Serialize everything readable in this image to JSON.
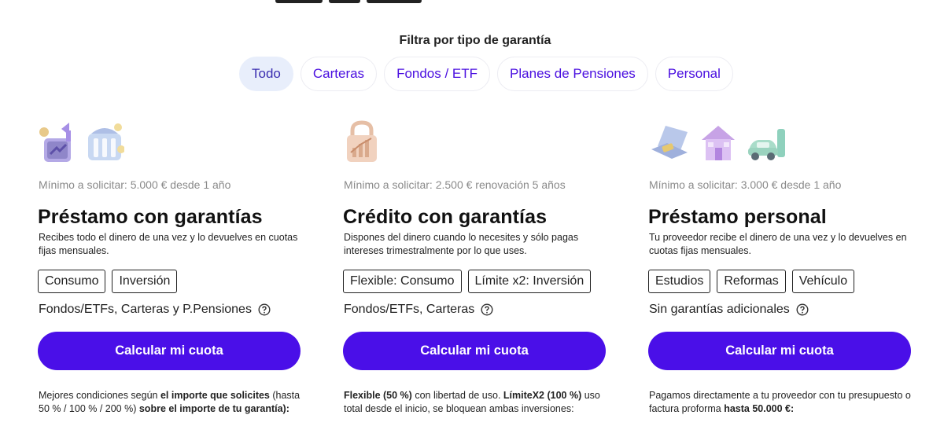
{
  "filter": {
    "title": "Filtra por tipo de garantía",
    "tabs": [
      {
        "label": "Todo",
        "active": true
      },
      {
        "label": "Carteras",
        "active": false
      },
      {
        "label": "Fondos / ETF",
        "active": false
      },
      {
        "label": "Planes de Pensiones",
        "active": false
      },
      {
        "label": "Personal",
        "active": false
      }
    ]
  },
  "colors": {
    "accent": "#4a0fe8",
    "tab_text": "#4b10e0",
    "tab_active_bg": "#e8eefb",
    "muted": "#8a8a8a"
  },
  "cards": [
    {
      "icons": [
        "graph-arrow-icon",
        "bank-building-icon"
      ],
      "minimum": "Mínimo a solicitar: 5.000 € desde 1 año",
      "title": "Préstamo con garantías",
      "description": "Recibes todo el dinero de una vez y lo devuelves en cuotas fijas mensuales.",
      "tags": [
        "Consumo",
        "Inversión"
      ],
      "guarantee": "Fondos/ETFs, Carteras y P.Pensiones",
      "cta": "Calcular mi cuota",
      "footer": {
        "p1": "Mejores condiciones según ",
        "b1": "el importe que solicites",
        "p2": " (hasta 50 % / 100 % / 200 %) ",
        "b2": "sobre el importe de tu garantía):",
        "p3": ""
      }
    },
    {
      "icons": [
        "padlock-chart-icon"
      ],
      "minimum": "Mínimo a solicitar: 2.500 € renovación 5 años",
      "title": "Crédito con garantías",
      "description": "Dispones del dinero cuando lo necesites y sólo pagas intereses trimestralmente por lo que uses.",
      "tags": [
        "Flexible: Consumo",
        "Límite x2: Inversión"
      ],
      "guarantee": "Fondos/ETFs, Carteras",
      "cta": "Calcular mi cuota",
      "footer": {
        "p1": "",
        "b1": "Flexible (50 %)",
        "p2": " con libertad de uso. ",
        "b2": "LímiteX2 (100 %)",
        "p3": " uso total desde el inicio, se bloquean ambas inversiones:"
      }
    },
    {
      "icons": [
        "laptop-icon",
        "house-icon",
        "car-charger-icon"
      ],
      "minimum": "Mínimo a solicitar: 3.000 € desde 1 año",
      "title": "Préstamo personal",
      "description": "Tu proveedor recibe el dinero de una vez y lo devuelves en cuotas fijas mensuales.",
      "tags": [
        "Estudios",
        "Reformas",
        "Vehículo"
      ],
      "guarantee": "Sin garantías adicionales",
      "cta": "Calcular mi cuota",
      "footer": {
        "p1": "Pagamos directamente a tu proveedor con tu presupuesto o factura proforma ",
        "b1": "hasta 50.000 €:",
        "p2": "",
        "b2": "",
        "p3": ""
      }
    }
  ]
}
